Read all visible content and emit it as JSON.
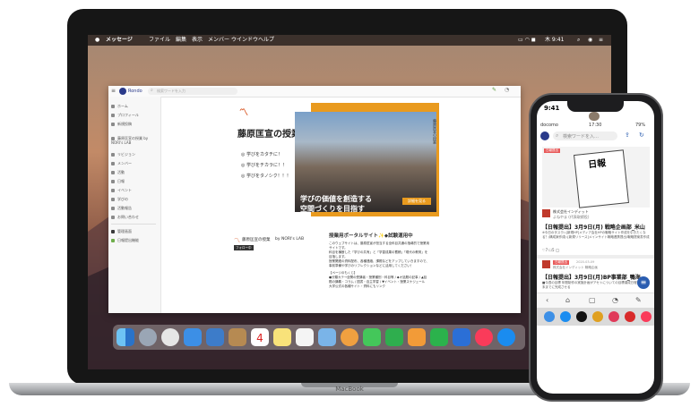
{
  "macbook": {
    "label": "MacBook"
  },
  "menubar": {
    "app_name": "メッセージ",
    "menus": [
      "ファイル",
      "編集",
      "表示",
      "メンバー",
      "ウインドウ",
      "ヘルプ"
    ],
    "clock": "木 9:41"
  },
  "app": {
    "brand": "Rondo",
    "search_placeholder": "検索ワードを入力",
    "sidebar": [
      {
        "label": "ホーム",
        "icon": "home-icon"
      },
      {
        "label": "プロフィール",
        "icon": "profile-icon"
      },
      {
        "label": "新規投稿",
        "icon": "new-post-icon"
      },
      {
        "label": "藤原匡宣の授業 by NORI's LAB",
        "icon": "community-icon"
      },
      {
        "label": "リビジョン",
        "icon": "revision-icon"
      },
      {
        "label": "メンバー",
        "icon": "members-icon"
      },
      {
        "label": "活動",
        "icon": "activity-icon"
      },
      {
        "label": "日報",
        "icon": "report-icon"
      },
      {
        "label": "イベント",
        "icon": "event-icon"
      },
      {
        "label": "学びの",
        "icon": "learning-icon"
      },
      {
        "label": "活動報告",
        "icon": "activity-report-icon"
      },
      {
        "label": "お問い合わせ",
        "icon": "contact-icon"
      },
      {
        "label": "管理画面",
        "icon": "admin-icon"
      },
      {
        "label": "日報提出機能",
        "icon": "report-submit-icon"
      }
    ],
    "hero": {
      "title": "藤原匡宣の授業",
      "bullets": [
        "学びをカタチに！",
        "学びをチカラに！！",
        "学びをタノシク！！！"
      ],
      "overlay_line1": "学びの価値を創造する",
      "overlay_line2": "空間づくりを目指す",
      "button": "詳細を見る",
      "vertical_text": "藤原匡宣の授業"
    },
    "community": {
      "name": "藤原匡宣の授業",
      "by": "by NORI's LAB",
      "follow_button": "フォロー中"
    },
    "post": {
      "title": "授業用ポータルサイト✨◆試験運用中",
      "paragraphs": [
        "このウェブサイトは、藤原匡宣が担当する全科目共通の指導的で授業用サイトです。",
        "科目を横断した「学びの共有」と「学習成果の蓄積」「現代の教育」を目指します。",
        "授業関連の資料配布、各種連絡、課題などをアップしていきますので、事前準備や学びのリフレクションなどに活用してください！",
        "【ページのもくじ】",
        "●分類カテ→全関の受講者・授業種別・科目等 / ◆オ話題の記事 / ▲話題の講義・コラム / 図書・自主学習 / ▼イベント・授業スケジュール",
        "大学公式の各種サイト・資料にもリンク"
      ]
    }
  },
  "phone": {
    "time": "9:41",
    "carrier": "docomo",
    "clock": "17:30",
    "battery": "79%",
    "search_placeholder": "検索ワードを入…",
    "badge1": "日報提出",
    "card_title": "日報",
    "company": "株式会社インディット",
    "author": "よねやま (代表取締役)",
    "post1_title": "【日報提出】3月9日(月) 戦略企画部_米山",
    "post1_body": "※今日のタスク▷[新規HP]メディア会社HPの戦略サイト作成を引きたくなる？/構成案作成▷[新規リリース]メインサイト戦略連携提出/戦略提案書作成",
    "likes": "7",
    "comments": "5",
    "badge2": "日報提出",
    "time2": "2020-03-09",
    "author2": "株式会社インディット 戦略企画",
    "post2_title": "【日報提出】3月9日(月)BP事業部_鴨海",
    "post2_body": "■今週の目標 年間制作の実施計画がアセトについての目標達成日程で3月末までに完成させる"
  },
  "dock": {
    "icons": [
      "finder-icon",
      "launchpad-icon",
      "safari-icon",
      "mail-icon",
      "photos-icon",
      "contacts-icon",
      "calendar-icon",
      "notes-icon",
      "reminders-icon",
      "photos2-icon",
      "messages-icon",
      "facetime-icon",
      "pages-icon",
      "numbers-icon",
      "keynote-icon",
      "music-icon",
      "appstore-icon",
      "settings-icon"
    ],
    "calendar_day": "4"
  }
}
